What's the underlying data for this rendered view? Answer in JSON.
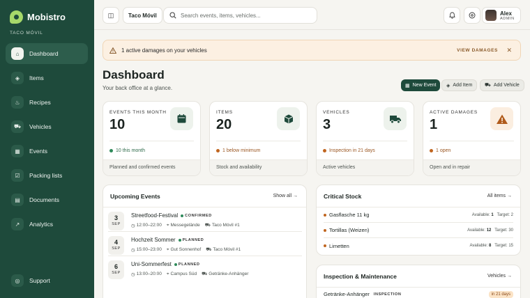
{
  "sidebar": {
    "brand": "Mobistro",
    "org": "TACO MÓVIL",
    "items": [
      {
        "label": "Dashboard",
        "icon": "home-icon",
        "glyph": "⌂"
      },
      {
        "label": "Items",
        "icon": "package-icon",
        "glyph": "◈"
      },
      {
        "label": "Recipes",
        "icon": "pot-icon",
        "glyph": "♨"
      },
      {
        "label": "Vehicles",
        "icon": "truck-icon",
        "glyph": "⛟"
      },
      {
        "label": "Events",
        "icon": "calendar-icon",
        "glyph": "▦"
      },
      {
        "label": "Packing lists",
        "icon": "checklist-icon",
        "glyph": "☑"
      },
      {
        "label": "Documents",
        "icon": "document-icon",
        "glyph": "▤"
      },
      {
        "label": "Analytics",
        "icon": "chart-icon",
        "glyph": "↗"
      }
    ],
    "support": {
      "label": "Support",
      "icon": "help-icon",
      "glyph": "◎"
    }
  },
  "topbar": {
    "org_chip": "Taco Móvil",
    "search_placeholder": "Search events, items, vehicles...",
    "user_name": "Alex",
    "user_role": "ADMIN"
  },
  "alert": {
    "text": "1 active damages on your vehicles",
    "link": "VIEW DAMAGES"
  },
  "header": {
    "title": "Dashboard",
    "subtitle": "Your back office at a glance.",
    "actions": {
      "new_event": "New Event",
      "add_item": "Add Item",
      "add_vehicle": "Add Vehicle"
    }
  },
  "stats": [
    {
      "label": "EVENTS THIS MONTH",
      "value": "10",
      "note": "10 this month",
      "foot": "Planned and confirmed events",
      "dot": "#2e8a5a"
    },
    {
      "label": "ITEMS",
      "value": "20",
      "note": "1 below minimum",
      "foot": "Stock and availability",
      "dot": "#c0651f"
    },
    {
      "label": "VEHICLES",
      "value": "3",
      "note": "Inspection in 21 days",
      "foot": "Active vehicles",
      "dot": "#c0651f"
    },
    {
      "label": "ACTIVE DAMAGES",
      "value": "1",
      "note": "1 open",
      "foot": "Open and in repair",
      "dot": "#c0651f"
    }
  ],
  "upcoming": {
    "title": "Upcoming Events",
    "link": "Show all →",
    "events": [
      {
        "day": "3",
        "month": "SEP",
        "name": "Streetfood-Festival",
        "status": "CONFIRMED",
        "status_color": "#2e8a5a",
        "time": "12:00–22:00",
        "place": "Messegelände",
        "vehicle": "Taco Móvil #1"
      },
      {
        "day": "4",
        "month": "SEP",
        "name": "Hochzeit Sommer",
        "status": "PLANNED",
        "status_color": "#2e8a5a",
        "time": "15:00–23:00",
        "place": "Gut Sonnenhof",
        "vehicle": "Taco Móvil #1"
      },
      {
        "day": "6",
        "month": "SEP",
        "name": "Uni-Sommerfest",
        "status": "PLANNED",
        "status_color": "#2e8a5a",
        "time": "13:00–20:00",
        "place": "Campus Süd",
        "vehicle": "Getränke-Anhänger"
      }
    ]
  },
  "critical_stock": {
    "title": "Critical Stock",
    "link": "All items →",
    "available_label": "Available:",
    "target_label": "Target:",
    "items": [
      {
        "name": "Gasflasche 11 kg",
        "available": "1",
        "target": "2"
      },
      {
        "name": "Tortillas (Weizen)",
        "available": "12",
        "target": "30"
      },
      {
        "name": "Limetten",
        "available": "8",
        "target": "15"
      }
    ]
  },
  "inspection": {
    "title": "Inspection & Maintenance",
    "link": "Vehicles →",
    "row": {
      "name": "Getränke-Anhänger",
      "badge": "INSPECTION",
      "due": "in 21 days"
    }
  }
}
